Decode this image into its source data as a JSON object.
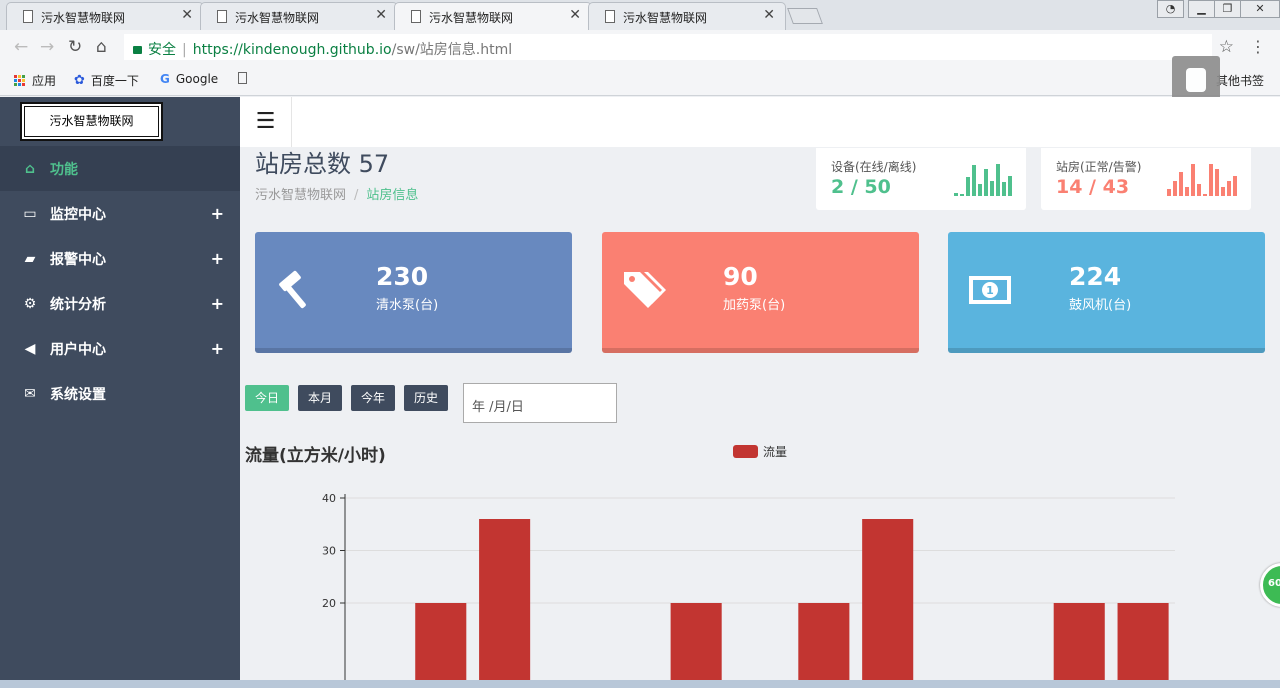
{
  "browser": {
    "tabs": [
      {
        "title": "污水智慧物联网",
        "active": false
      },
      {
        "title": "污水智慧物联网",
        "active": false
      },
      {
        "title": "污水智慧物联网",
        "active": true
      },
      {
        "title": "污水智慧物联网",
        "active": false
      }
    ],
    "security_label": "安全",
    "url_host": "https://kindenough.github.io",
    "url_path": "/sw/站房信息.html",
    "bookmarks": [
      "应用",
      "百度一下",
      "Google"
    ],
    "other_bookmarks": "其他书签"
  },
  "app": {
    "logo_text": "污水智慧物联网",
    "sidebar": [
      {
        "label": "功能",
        "icon": "home-icon",
        "glyph": "⌂",
        "active": true,
        "expandable": false
      },
      {
        "label": "监控中心",
        "icon": "laptop-icon",
        "glyph": "▭",
        "active": false,
        "expandable": true
      },
      {
        "label": "报警中心",
        "icon": "book-icon",
        "glyph": "▰",
        "active": false,
        "expandable": true
      },
      {
        "label": "统计分析",
        "icon": "cogs-icon",
        "glyph": "⚙",
        "active": false,
        "expandable": true
      },
      {
        "label": "用户中心",
        "icon": "bullhorn-icon",
        "glyph": "◀",
        "active": false,
        "expandable": true
      },
      {
        "label": "系统设置",
        "icon": "envelope-icon",
        "glyph": "✉",
        "active": false,
        "expandable": false
      }
    ],
    "page_title": "站房总数 57",
    "breadcrumb": {
      "root": "污水智慧物联网",
      "current": "站房信息"
    },
    "mini_stats": [
      {
        "label": "设备(在线/离线)",
        "value": "2 / 50",
        "color": "#4fc08d",
        "spark": [
          0.1,
          0.05,
          0.55,
          0.9,
          0.35,
          0.8,
          0.45,
          0.95,
          0.4,
          0.6
        ]
      },
      {
        "label": "站房(正常/告警)",
        "value": "14 / 43",
        "color": "#fa8072",
        "spark": [
          0.2,
          0.45,
          0.7,
          0.25,
          0.95,
          0.35,
          0.05,
          0.95,
          0.8,
          0.25,
          0.45,
          0.6
        ]
      }
    ],
    "cards": [
      {
        "value": "230",
        "label": "清水泵(台)",
        "icon": "gavel-icon",
        "glyph": "⚒",
        "color": "#6889bf"
      },
      {
        "value": "90",
        "label": "加药泵(台)",
        "icon": "tags-icon",
        "glyph": "🏷",
        "color": "#fa8072"
      },
      {
        "value": "224",
        "label": "鼓风机(台)",
        "icon": "money-icon",
        "glyph": "💵",
        "color": "#5ab4de"
      }
    ],
    "filters": [
      "今日",
      "本月",
      "今年",
      "历史"
    ],
    "active_filter": "今日",
    "date_placeholder": "年 /月/日",
    "chat_badge": "60"
  },
  "chart_data": {
    "type": "bar",
    "title": "流量(立方米/小时)",
    "series": [
      {
        "name": "流量",
        "color": "#c23531",
        "values": [
          0,
          20,
          36,
          0,
          0,
          20,
          0,
          20,
          36,
          0,
          0,
          20,
          20
        ]
      }
    ],
    "yticks": [
      20,
      30,
      40
    ],
    "ylim": [
      0,
      40
    ],
    "grid": true,
    "legend_position": "top-center"
  }
}
